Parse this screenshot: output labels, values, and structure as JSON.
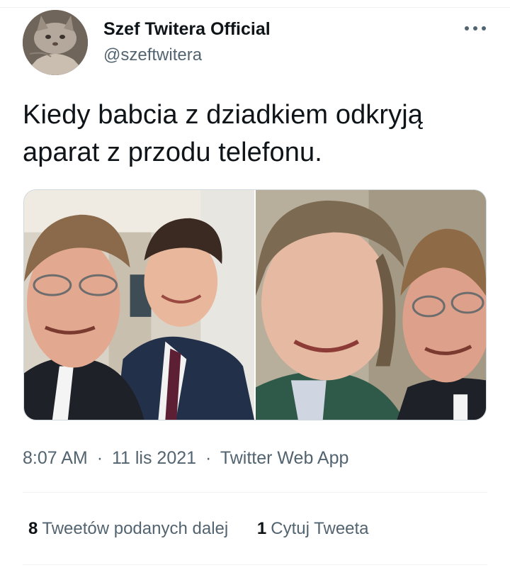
{
  "author": {
    "display_name": "Szef Twitera Official",
    "handle": "@szeftwitera",
    "avatar_icon": "cat-avatar"
  },
  "tweet": {
    "text": "Kiedy babcia z dziadkiem odkryją aparat z przodu telefonu.",
    "media_count": 2
  },
  "meta": {
    "time": "8:07 AM",
    "separator": "·",
    "date": "11 lis 2021",
    "source": "Twitter Web App"
  },
  "stats": {
    "retweets_count": "8",
    "retweets_label": "Tweetów podanych dalej",
    "quotes_count": "1",
    "quotes_label": "Cytuj Tweeta"
  },
  "icons": {
    "more": "more-horizontal-icon"
  },
  "colors": {
    "text_primary": "#0f1419",
    "text_secondary": "#536471",
    "divider": "#eff3f4",
    "media_border": "#cfd9de"
  }
}
